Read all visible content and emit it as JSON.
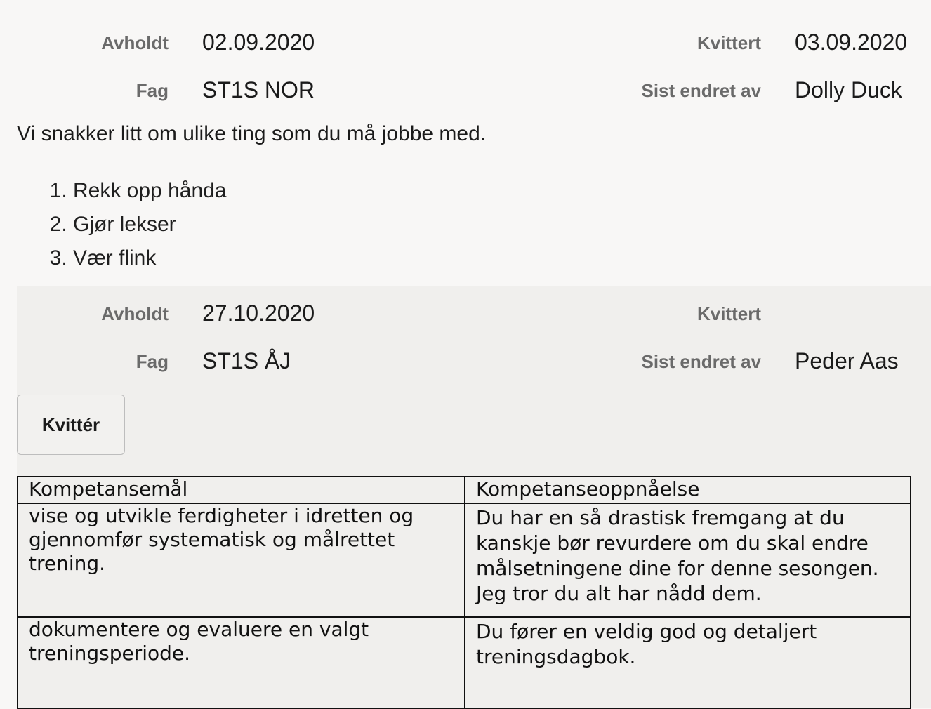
{
  "entries": [
    {
      "held_label": "Avholdt",
      "held_date": "02.09.2020",
      "receipt_label": "Kvittert",
      "receipt_date": "03.09.2020",
      "subject_label": "Fag",
      "subject": "ST1S NOR",
      "changed_by_label": "Sist endret av",
      "changed_by": "Dolly Duck",
      "summary": "Vi snakker litt om ulike ting som du må jobbe med.",
      "list_items": [
        "Rekk opp hånda",
        "Gjør lekser",
        "Vær flink"
      ]
    },
    {
      "held_label": "Avholdt",
      "held_date": "27.10.2020",
      "receipt_label": "Kvittert",
      "receipt_date": "",
      "subject_label": "Fag",
      "subject": "ST1S ÅJ",
      "changed_by_label": "Sist endret av",
      "changed_by": "Peder Aas",
      "receipt_button": "Kvittér",
      "table": {
        "headers": [
          "Kompetansemål",
          "Kompetanseoppnåelse"
        ],
        "rows": [
          [
            "vise og utvikle ferdigheter i idretten og gjennomfør systematisk og målrettet trening.",
            " Du har en så drastisk fremgang at du kanskje bør revurdere om du skal endre målsetningene dine for denne sesongen. Jeg tror du alt har nådd dem."
          ],
          [
            "dokumentere og evaluere en valgt treningsperiode.",
            "Du fører en veldig god og detaljert treningsdagbok."
          ]
        ]
      }
    }
  ]
}
